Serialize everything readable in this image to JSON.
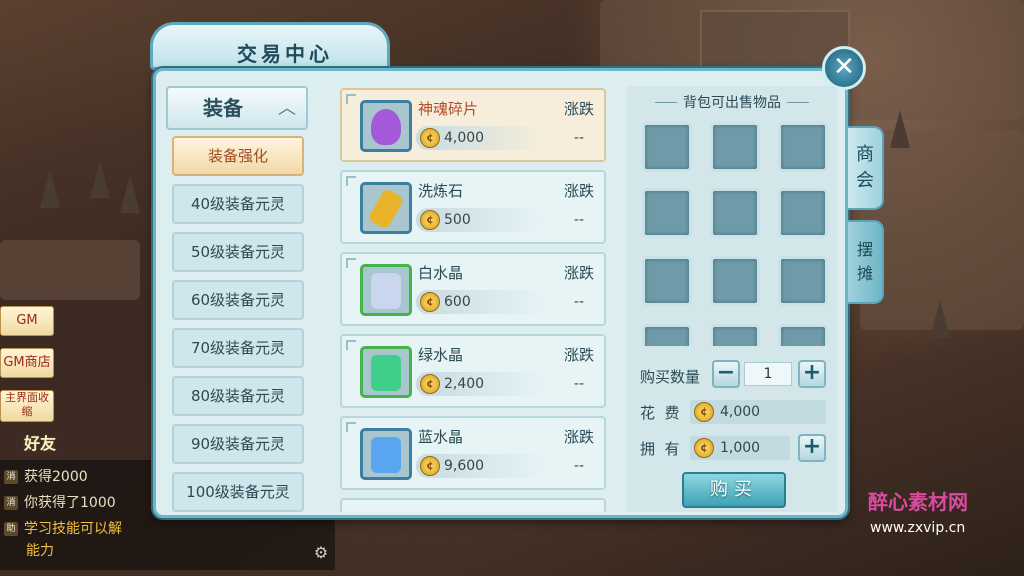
{
  "window": {
    "title": "交易中心",
    "close_icon": "close-icon"
  },
  "category": {
    "label": "装备",
    "arrow": "^"
  },
  "sub_items": [
    {
      "label": "装备强化",
      "active": true
    },
    {
      "label": "40级装备元灵",
      "active": false
    },
    {
      "label": "50级装备元灵",
      "active": false
    },
    {
      "label": "60级装备元灵",
      "active": false
    },
    {
      "label": "70级装备元灵",
      "active": false
    },
    {
      "label": "80级装备元灵",
      "active": false
    },
    {
      "label": "90级装备元灵",
      "active": false
    },
    {
      "label": "100级装备元灵",
      "active": false
    }
  ],
  "items": [
    {
      "name": "神魂碎片",
      "price": "4,000",
      "trend_label": "涨跌",
      "trend": "--",
      "icon": "purple-soul-icon",
      "color": "#a45ad8",
      "selected": true
    },
    {
      "name": "洗炼石",
      "price": "500",
      "trend_label": "涨跌",
      "trend": "--",
      "icon": "gold-crystal-icon",
      "color": "#e8b52a",
      "selected": false
    },
    {
      "name": "白水晶",
      "price": "600",
      "trend_label": "涨跌",
      "trend": "--",
      "icon": "white-crystal-icon",
      "color": "#c9d6ee",
      "selected": false
    },
    {
      "name": "绿水晶",
      "price": "2,400",
      "trend_label": "涨跌",
      "trend": "--",
      "icon": "green-crystal-icon",
      "color": "#3fcf8a",
      "selected": false
    },
    {
      "name": "蓝水晶",
      "price": "9,600",
      "trend_label": "涨跌",
      "trend": "--",
      "icon": "blue-crystal-icon",
      "color": "#5aa6f0",
      "selected": false
    }
  ],
  "bag": {
    "title": "背包可出售物品"
  },
  "side_tabs": [
    {
      "label": "商会"
    },
    {
      "label": "摆摊"
    }
  ],
  "purchase": {
    "qty_label": "购买数量",
    "qty": "1",
    "cost_label": "花  费",
    "cost": "4,000",
    "own_label": "拥  有",
    "own": "1,000",
    "buy_label": "购买"
  },
  "hud": {
    "gm": "GM",
    "gm_shop": "GM商店",
    "collapse": "主界面收缩",
    "friend": "好友"
  },
  "chat": [
    {
      "tag": "消",
      "text": "获得2000"
    },
    {
      "tag": "消",
      "text": "你获得了1000"
    },
    {
      "tag": "助",
      "text": "学习技能可以解"
    },
    {
      "tag": "",
      "text": "能力"
    }
  ],
  "watermark": {
    "text": "醉心素材网",
    "url": "www.zxvip.cn"
  }
}
